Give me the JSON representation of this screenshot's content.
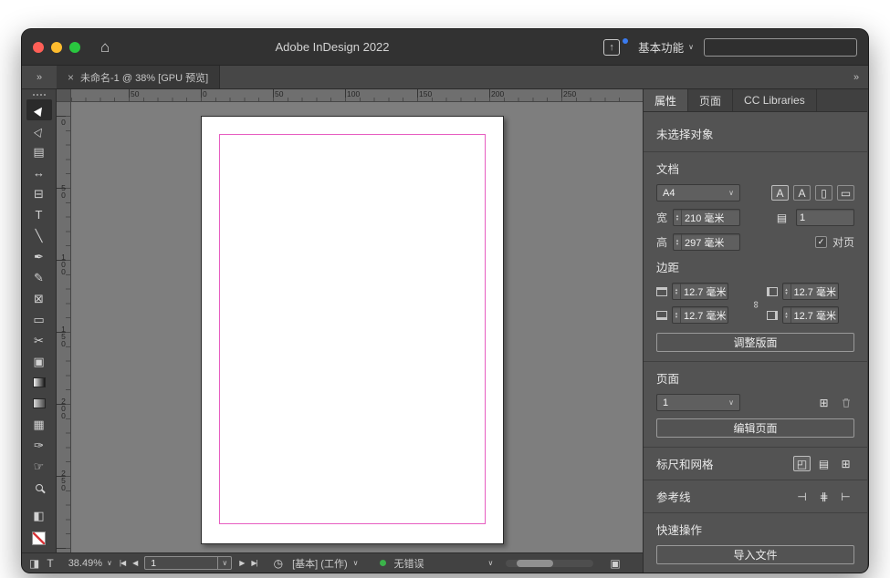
{
  "titlebar": {
    "title": "Adobe InDesign 2022",
    "workspace": "基本功能",
    "search_value": ""
  },
  "tabbar": {
    "left_overflow": "»",
    "right_overflow": "»",
    "close": "×",
    "doc_title": "未命名-1 @ 38% [GPU 预览]"
  },
  "tools": [
    {
      "name": "selection-tool",
      "glyph": "▶",
      "active": true
    },
    {
      "name": "direct-selection-tool",
      "glyph": "▷"
    },
    {
      "name": "page-tool",
      "glyph": "▤"
    },
    {
      "name": "gap-tool",
      "glyph": "↔"
    },
    {
      "name": "content-collector-tool",
      "glyph": "⊟"
    },
    {
      "name": "type-tool",
      "glyph": "T"
    },
    {
      "name": "line-tool",
      "glyph": "╲"
    },
    {
      "name": "pen-tool",
      "glyph": "✒"
    },
    {
      "name": "pencil-tool",
      "glyph": "✎"
    },
    {
      "name": "rectangle-frame-tool",
      "glyph": "⊠"
    },
    {
      "name": "rectangle-tool",
      "glyph": "▭"
    },
    {
      "name": "scissors-tool",
      "glyph": "✂"
    },
    {
      "name": "free-transform-tool",
      "glyph": "▣"
    },
    {
      "name": "gradient-swatch-tool",
      "glyph": ""
    },
    {
      "name": "gradient-feather-tool",
      "glyph": ""
    },
    {
      "name": "note-tool",
      "glyph": "▦"
    },
    {
      "name": "eyedropper-tool",
      "glyph": "✑"
    },
    {
      "name": "hand-tool",
      "glyph": "☞"
    },
    {
      "name": "zoom-tool",
      "glyph": ""
    }
  ],
  "toolbar_extras": {
    "screen_mode": "◧"
  },
  "rulers": {
    "h": [
      "50",
      "0",
      "50",
      "100",
      "150",
      "200",
      "250"
    ],
    "v": [
      "0",
      "50",
      "100",
      "150",
      "200",
      "250"
    ]
  },
  "panel": {
    "tabs": [
      "属性",
      "页面",
      "CC Libraries"
    ],
    "no_selection": "未选择对象",
    "doc": {
      "heading": "文档",
      "preset": "A4",
      "icons": [
        "A",
        "A",
        "▯",
        "▭"
      ],
      "width_label": "宽",
      "width_value": "210 毫米",
      "height_label": "高",
      "height_value": "297 毫米",
      "pages_icon": "▤",
      "page_count": "1",
      "facing_pages": "对页",
      "check": "✓"
    },
    "margins": {
      "heading": "边距",
      "top": "12.7 毫米",
      "bottom": "12.7 毫米",
      "inside": "12.7 毫米",
      "outside": "12.7 毫米"
    },
    "adjust_layout": "调整版面",
    "pages": {
      "heading": "页面",
      "current": "1",
      "add_icon": "⊞",
      "edit": "编辑页面"
    },
    "rg_icons": [
      "◰",
      "▤",
      "⊞"
    ],
    "guide_icons": [
      "⊣",
      "⋕",
      "⊢"
    ],
    "rulers_grids_label": "标尺和网格",
    "guides_label": "参考线",
    "quick_actions_label": "快速操作",
    "import_file": "导入文件"
  },
  "statusbar": {
    "container_icon": "◨",
    "text_icon": "T",
    "zoom": "38.49%",
    "nav_first": "|◀",
    "nav_prev": "◀",
    "nav_next": "▶",
    "nav_last": "▶|",
    "page": "1",
    "preflight_icon": "◷",
    "preflight_profile": "[基本] (工作)",
    "no_errors": "无错误",
    "panel_toggle": "▣"
  }
}
